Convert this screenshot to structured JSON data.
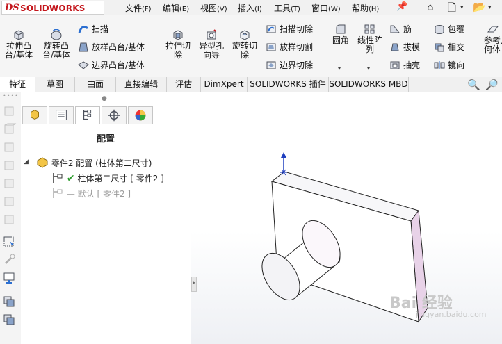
{
  "app": {
    "logo_mark": "DS",
    "logo_text": "SOLIDWORKS"
  },
  "menu": [
    {
      "label": "文件",
      "key": "(F)"
    },
    {
      "label": "编辑",
      "key": "(E)"
    },
    {
      "label": "视图",
      "key": "(V)"
    },
    {
      "label": "插入",
      "key": "(I)"
    },
    {
      "label": "工具",
      "key": "(T)"
    },
    {
      "label": "窗口",
      "key": "(W)"
    },
    {
      "label": "帮助",
      "key": "(H)"
    }
  ],
  "ribbon": {
    "extrude_boss": "拉伸凸台/基体",
    "revolve_boss": "旋转凸台/基体",
    "sweep": "扫描",
    "loft_boss": "放样凸台/基体",
    "boundary_boss": "边界凸台/基体",
    "extrude_cut": "拉伸切除",
    "hole_wizard": "异型孔向导",
    "revolve_cut": "旋转切除",
    "sweep_cut": "扫描切除",
    "loft_cut": "放样切割",
    "boundary_cut": "边界切除",
    "fillet": "圆角",
    "linear_pattern": "线性阵列",
    "rib": "筋",
    "draft": "拔模",
    "shell": "抽壳",
    "wrap": "包覆",
    "intersect": "相交",
    "mirror": "镜向",
    "reference_geometry": "参考几何体"
  },
  "tabs": [
    "特征",
    "草图",
    "曲面",
    "直接编辑",
    "评估",
    "DimXpert",
    "SOLIDWORKS 插件",
    "SOLIDWORKS MBD"
  ],
  "panel": {
    "title": "配置",
    "root": "零件2 配置  (柱体第二尺寸)",
    "config_active": "柱体第二尺寸 [ 零件2 ]",
    "config_default": "默认 [ 零件2 ]"
  },
  "watermark": {
    "main": "Bai 经验",
    "sub": "jingyan.baidu.com"
  },
  "colors": {
    "brand": "#c4161c",
    "accent_blue": "#2b6fd1",
    "check_green": "#2c9a2c"
  }
}
